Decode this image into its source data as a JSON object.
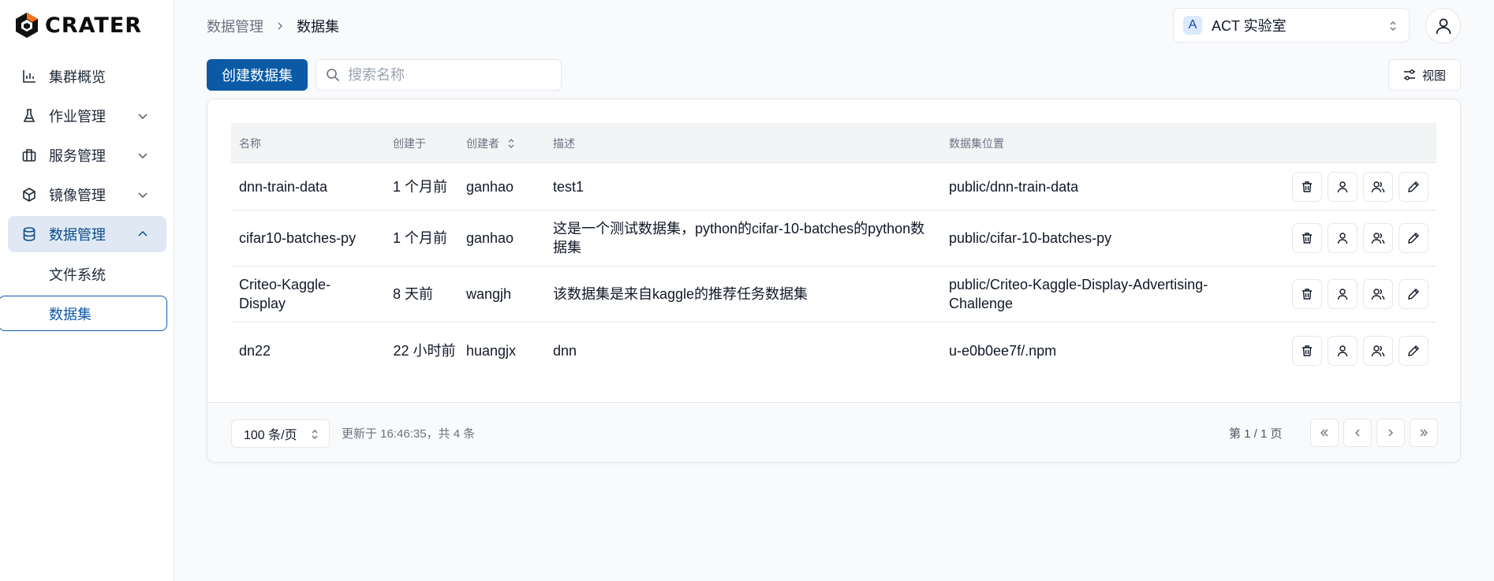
{
  "brand": {
    "name": "CRATER",
    "logo_color": "#f97316"
  },
  "sidebar": {
    "items": [
      {
        "label": "集群概览",
        "icon": "bar-chart-icon",
        "expandable": false
      },
      {
        "label": "作业管理",
        "icon": "flask-icon",
        "expandable": true
      },
      {
        "label": "服务管理",
        "icon": "briefcase-icon",
        "expandable": true
      },
      {
        "label": "镜像管理",
        "icon": "package-icon",
        "expandable": true
      },
      {
        "label": "数据管理",
        "icon": "database-icon",
        "expandable": true,
        "active": true
      }
    ],
    "sub_items": [
      {
        "label": "文件系统"
      },
      {
        "label": "数据集",
        "selected": true
      }
    ]
  },
  "breadcrumb": {
    "parent": "数据管理",
    "current": "数据集"
  },
  "team": {
    "badge": "A",
    "name": "ACT 实验室"
  },
  "toolbar": {
    "create_label": "创建数据集",
    "search_placeholder": "搜索名称",
    "view_label": "视图"
  },
  "table": {
    "columns": [
      "名称",
      "创建于",
      "创建者",
      "描述",
      "数据集位置"
    ],
    "rows": [
      {
        "name": "dnn-train-data",
        "created": "1 个月前",
        "creator": "ganhao",
        "description": "test1",
        "location": "public/dnn-train-data"
      },
      {
        "name": "cifar10-batches-py",
        "created": "1 个月前",
        "creator": "ganhao",
        "description": "这是一个测试数据集，python的cifar-10-batches的python数据集",
        "location": "public/cifar-10-batches-py"
      },
      {
        "name": "Criteo-Kaggle-Display",
        "created": "8 天前",
        "creator": "wangjh",
        "description": "该数据集是来自kaggle的推荐任务数据集",
        "location": "public/Criteo-Kaggle-Display-Advertising-Challenge"
      },
      {
        "name": "dn22",
        "created": "22 小时前",
        "creator": "huangjx",
        "description": "dnn",
        "location": "u-e0b0ee7f/.npm"
      }
    ]
  },
  "footer": {
    "page_size": "100 条/页",
    "updated": "更新于 16:46:35，共 4 条",
    "page_info": "第 1 / 1 页"
  },
  "colors": {
    "primary": "#0a5aa6",
    "active_bg": "#e0e9f3"
  }
}
